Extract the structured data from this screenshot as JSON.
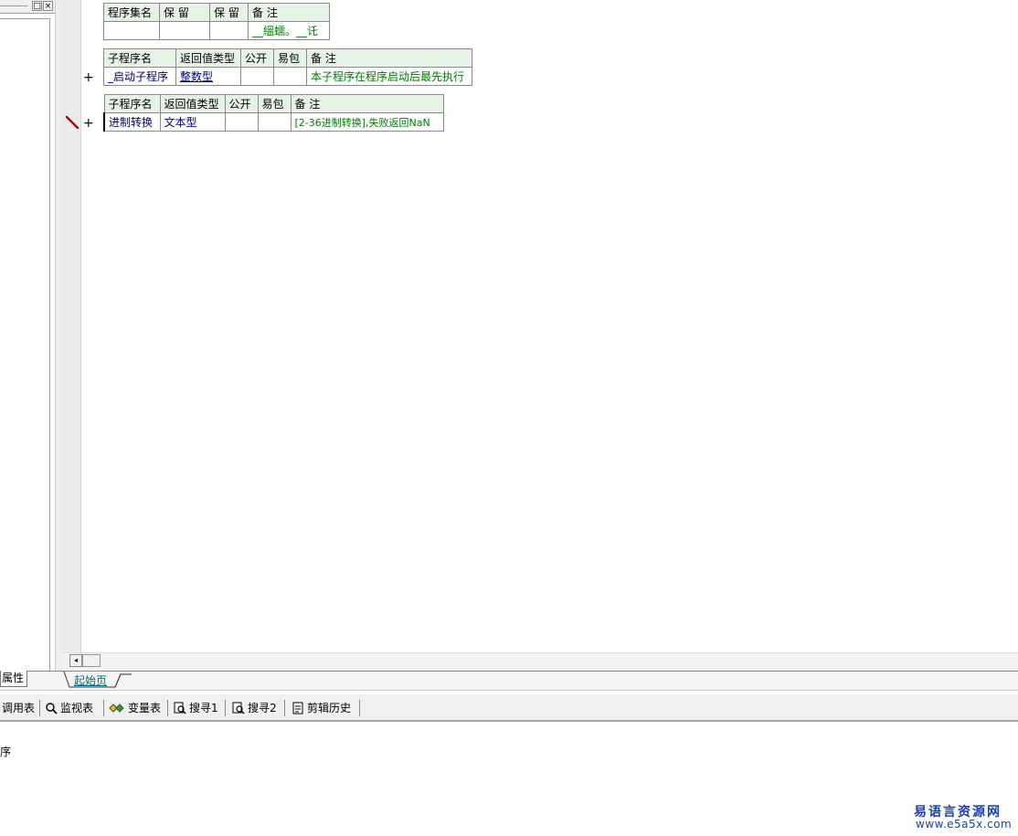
{
  "left_panel": {
    "restore_glyph": "□",
    "close_glyph": "×",
    "tab_label": "属性"
  },
  "table_set": {
    "headers": [
      "程序集名",
      "保 留",
      "保 留",
      "备 注"
    ],
    "row": [
      "",
      "",
      "",
      "__縕蠕。__讬"
    ]
  },
  "table_sub1": {
    "headers": [
      "子程序名",
      "返回值类型",
      "公开",
      "易包",
      "备 注"
    ],
    "row": [
      "_启动子程序",
      "整数型",
      "",
      "",
      "本子程序在程序启动后最先执行"
    ]
  },
  "table_sub2": {
    "headers": [
      "子程序名",
      "返回值类型",
      "公开",
      "易包",
      "备 注"
    ],
    "row": [
      "进制转换",
      "文本型",
      "",
      "",
      "[2-36进制转换],失败返回NaN"
    ]
  },
  "expand_glyph": "+",
  "editor": {
    "scroll_left_glyph": "◂",
    "active_tab": "起始页"
  },
  "toolbar": {
    "items": [
      {
        "label": "调用表",
        "icon": "call-table-icon"
      },
      {
        "label": "监视表",
        "icon": "magnifier-icon"
      },
      {
        "label": "变量表",
        "icon": "variables-icon"
      },
      {
        "label": "搜寻1",
        "icon": "search-doc-icon"
      },
      {
        "label": "搜寻2",
        "icon": "search-doc-icon"
      },
      {
        "label": "剪辑历史",
        "icon": "clipboard-icon"
      }
    ]
  },
  "output": {
    "text": "序"
  },
  "watermark": {
    "line1": "易语言资源网",
    "line2": "www.e5a5x.com"
  },
  "colors": {
    "header_bg": "#e7f2e7",
    "comment_green": "#007a00",
    "type_blue": "#00006e",
    "watermark_blue": "#1b3fa8"
  }
}
